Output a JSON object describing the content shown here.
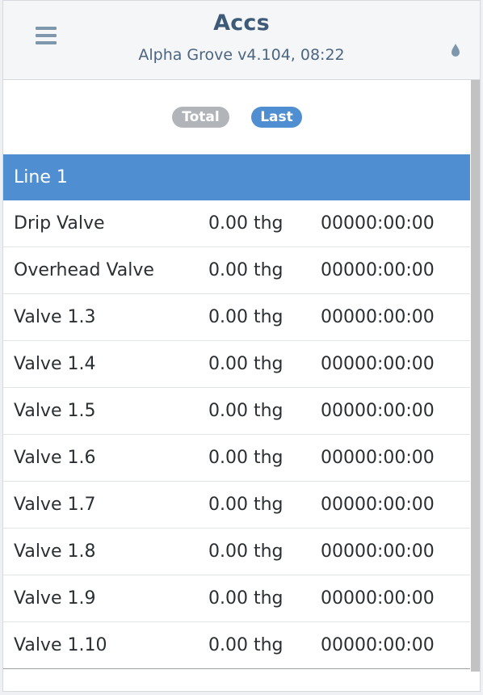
{
  "header": {
    "title": "Accs",
    "subtitle": "Alpha Grove v4.104, 08:22",
    "menu_icon": "hamburger-menu-icon",
    "status_icon": "water-drop-icon",
    "status_icon_color": "#7f97ad"
  },
  "segments": [
    {
      "label": "Total",
      "selected": false
    },
    {
      "label": "Last",
      "selected": true
    }
  ],
  "section": {
    "title": "Line 1"
  },
  "rows": [
    {
      "name": "Drip Valve",
      "amount": "0.00 thg",
      "time": "00000:00:00"
    },
    {
      "name": "Overhead Valve",
      "amount": "0.00 thg",
      "time": "00000:00:00"
    },
    {
      "name": "Valve 1.3",
      "amount": "0.00 thg",
      "time": "00000:00:00"
    },
    {
      "name": "Valve 1.4",
      "amount": "0.00 thg",
      "time": "00000:00:00"
    },
    {
      "name": "Valve 1.5",
      "amount": "0.00 thg",
      "time": "00000:00:00"
    },
    {
      "name": "Valve 1.6",
      "amount": "0.00 thg",
      "time": "00000:00:00"
    },
    {
      "name": "Valve 1.7",
      "amount": "0.00 thg",
      "time": "00000:00:00"
    },
    {
      "name": "Valve 1.8",
      "amount": "0.00 thg",
      "time": "00000:00:00"
    },
    {
      "name": "Valve 1.9",
      "amount": "0.00 thg",
      "time": "00000:00:00"
    },
    {
      "name": "Valve 1.10",
      "amount": "0.00 thg",
      "time": "00000:00:00"
    }
  ],
  "colors": {
    "accent": "#4f8fd1",
    "segment_inactive": "#b1b5ba",
    "title": "#3d5a78"
  }
}
